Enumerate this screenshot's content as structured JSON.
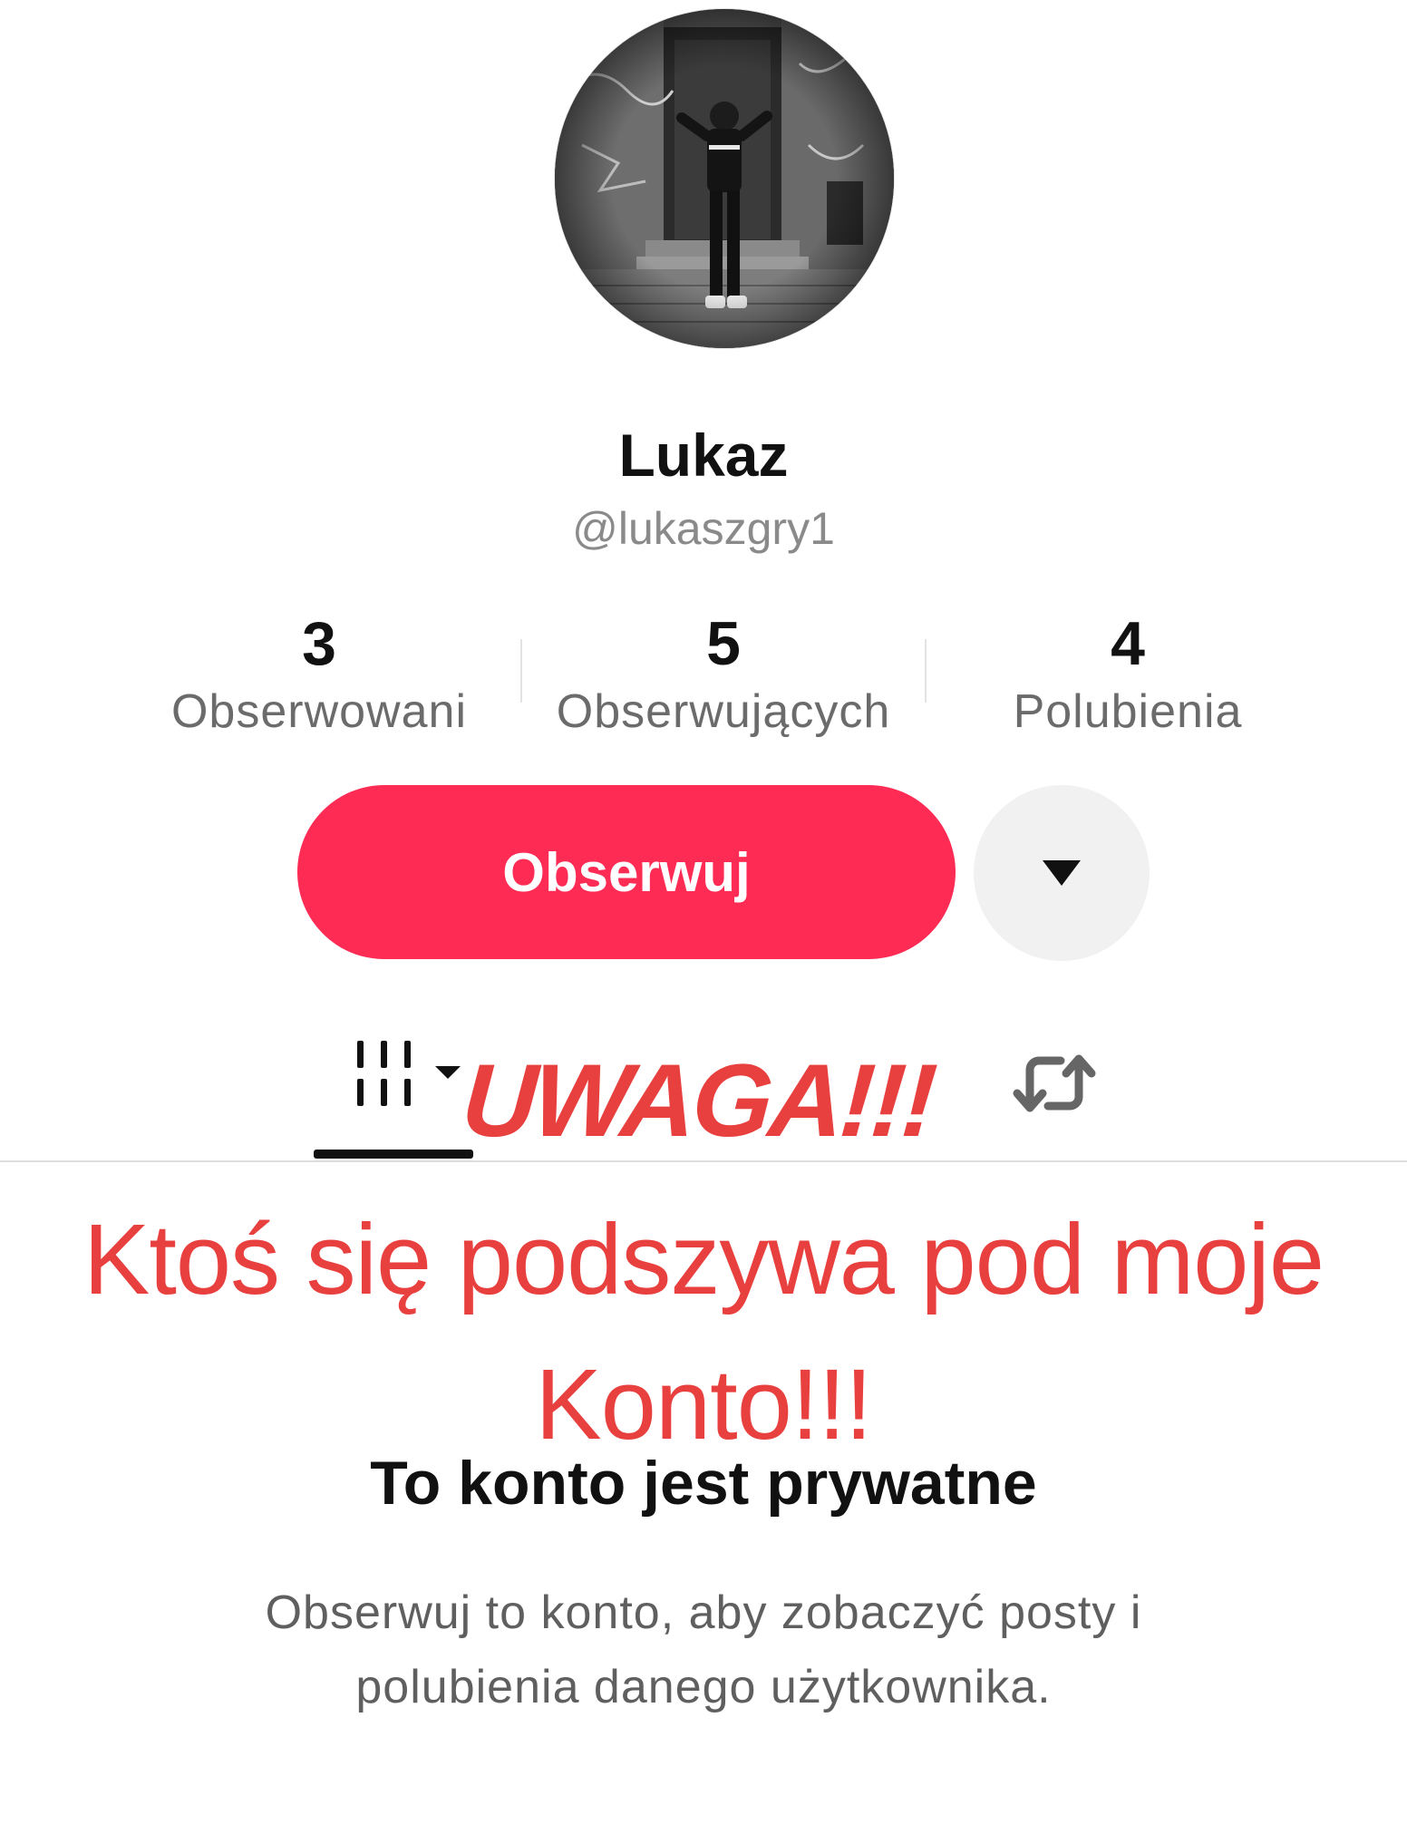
{
  "profile": {
    "display_name": "Lukaz",
    "username": "@lukaszgry1",
    "avatar_icon": "profile-photo"
  },
  "stats": [
    {
      "value": "3",
      "label": "Obserwowani"
    },
    {
      "value": "5",
      "label": "Obserwujących"
    },
    {
      "value": "4",
      "label": "Polubienia"
    }
  ],
  "actions": {
    "follow_label": "Obserwuj",
    "more_icon": "caret-down-icon"
  },
  "tabs": {
    "videos_icon": "grid-videos-icon",
    "reposts_icon": "repost-icon",
    "active": "videos"
  },
  "overlay": {
    "title": "UWAGA!!!",
    "message": "Ktoś się podszywa pod moje Konto!!!"
  },
  "private": {
    "title": "To konto jest prywatne",
    "description": "Obserwuj to konto, aby zobaczyć posty i polubienia danego użytkownika."
  },
  "colors": {
    "accent": "#fe2c55",
    "overlay_text": "#e8403e",
    "muted_text": "#8a8a8a"
  }
}
